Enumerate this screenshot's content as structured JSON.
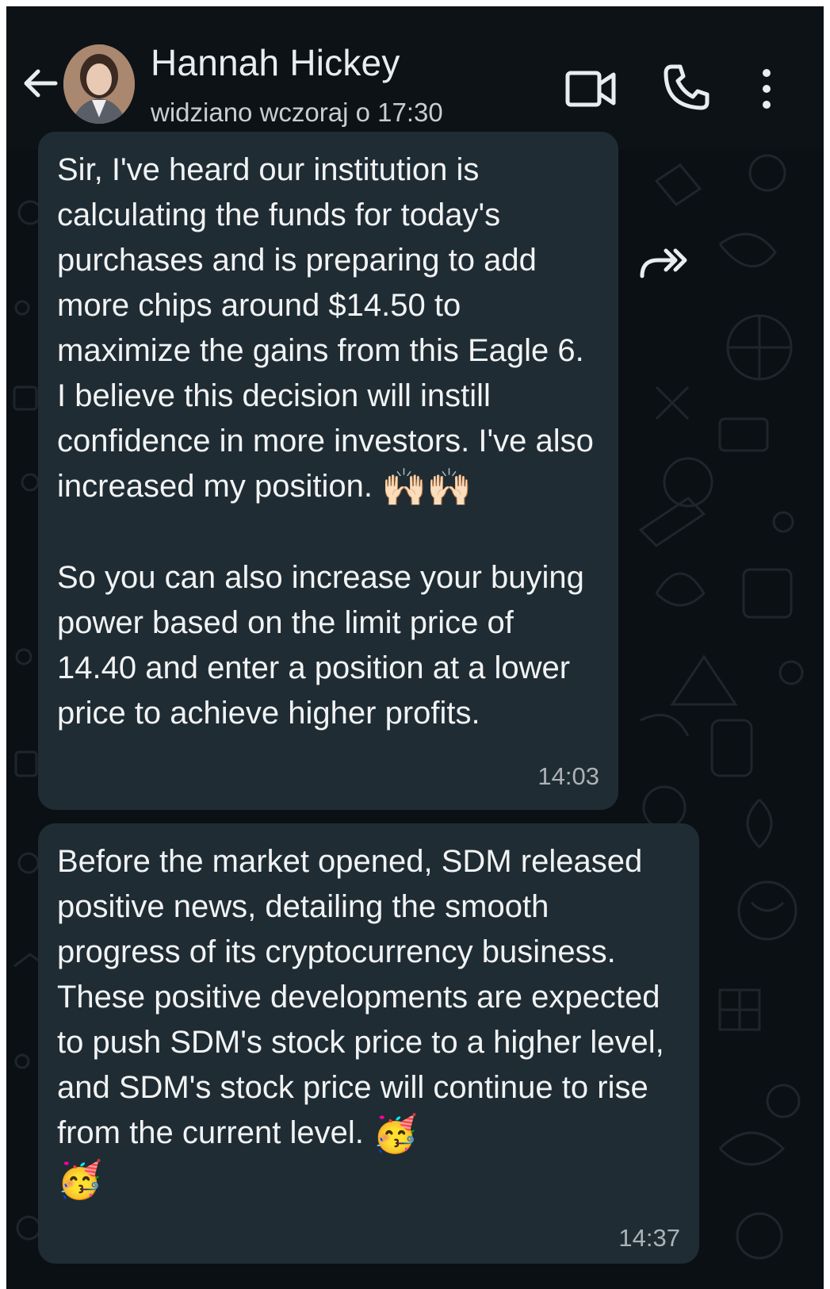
{
  "header": {
    "contact_name": "Hannah Hickey",
    "last_seen": "widziano wczoraj o 17:30",
    "icons": [
      "back-arrow-icon",
      "avatar",
      "video-call-icon",
      "voice-call-icon",
      "more-options-icon"
    ]
  },
  "messages": [
    {
      "paragraph_1": "Sir, I've heard our institution is calculating the funds for today's purchases and is preparing to add more chips around $14.50 to maximize the gains from this Eagle 6. I believe this decision will instill confidence in more investors. I've also increased my position.",
      "emoji_1": "🙌🏻🙌🏻",
      "paragraph_2": "So you can also increase your buying power based on the limit price of 14.40 and enter a position at a lower price to achieve higher profits.",
      "time": "14:03"
    },
    {
      "text": "Before the market opened, SDM released positive news, detailing the smooth progress of its cryptocurrency business. These positive developments are expected to push SDM's stock price to a higher level, and SDM's stock price will continue to rise from the current level.",
      "emoji": "🥳",
      "emoji_2": "🥳",
      "time": "14:37"
    }
  ],
  "colors": {
    "header_bg": "#0d1216",
    "chat_bg": "#0b1014",
    "bubble_bg": "#202c33",
    "text": "#f1f3f4",
    "timestamp": "#aab2b7"
  }
}
